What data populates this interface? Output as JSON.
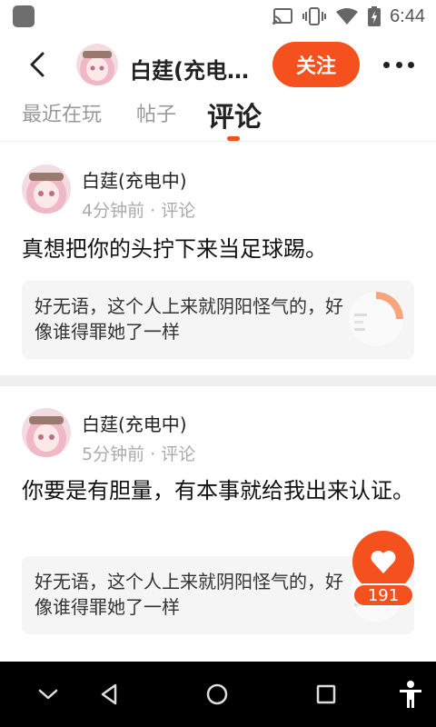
{
  "status_bar": {
    "time": "6:44",
    "icons": [
      "cast-icon",
      "vibrate-icon",
      "wifi-icon",
      "battery-charging-icon"
    ]
  },
  "header": {
    "title": "白莛(充电…",
    "follow_label": "关注"
  },
  "tabs": [
    {
      "label": "最近在玩",
      "active": false
    },
    {
      "label": "帖子",
      "active": false
    },
    {
      "label": "评论",
      "active": true
    }
  ],
  "comments": [
    {
      "user": "白莛(充电中)",
      "meta": "4分钟前 · 评论",
      "text": "真想把你的头拧下来当足球踢。",
      "quote": "好无语，这个人上来就阴阳怪气的，好像谁得罪她了一样"
    },
    {
      "user": "白莛(充电中)",
      "meta": "5分钟前 · 评论",
      "text": "你要是有胆量，有本事就给我出来认证。",
      "quote": "好无语，这个人上来就阴阳怪气的，好像谁得罪她了一样"
    }
  ],
  "like": {
    "count": "191"
  },
  "colors": {
    "accent": "#f4511e",
    "nav_background": "#000000"
  }
}
